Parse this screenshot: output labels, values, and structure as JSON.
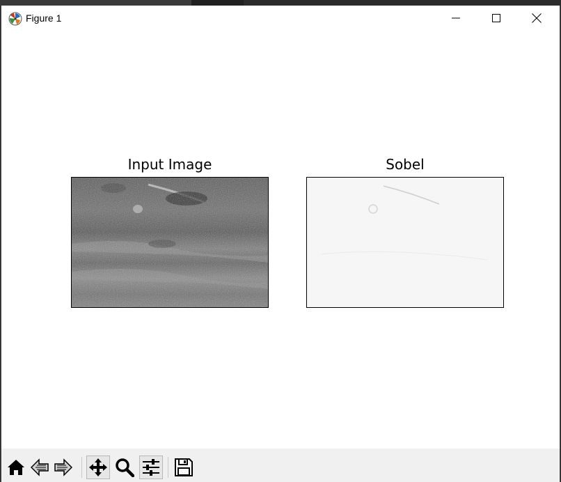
{
  "window": {
    "title": "Figure 1",
    "icon": "matplotlib-icon",
    "controls": [
      "minimize-icon",
      "maximize-icon",
      "close-icon"
    ]
  },
  "figure": {
    "subplots": [
      {
        "title": "Input Image",
        "content": "grayscale-photo"
      },
      {
        "title": "Sobel",
        "content": "sobel-edge-map"
      }
    ]
  },
  "toolbar": {
    "buttons": [
      {
        "name": "home",
        "icon": "home-icon"
      },
      {
        "name": "back",
        "icon": "back-arrow-icon"
      },
      {
        "name": "forward",
        "icon": "forward-arrow-icon"
      },
      {
        "name": "pan",
        "icon": "move-icon"
      },
      {
        "name": "zoom",
        "icon": "magnifier-icon"
      },
      {
        "name": "configure-subplots",
        "icon": "sliders-icon"
      },
      {
        "name": "save",
        "icon": "floppy-disk-icon"
      }
    ]
  },
  "colors": {
    "window_bg": "#ffffff",
    "toolbar_bg": "#f0f0f0",
    "desktop_bg": "#2b2b2b"
  }
}
